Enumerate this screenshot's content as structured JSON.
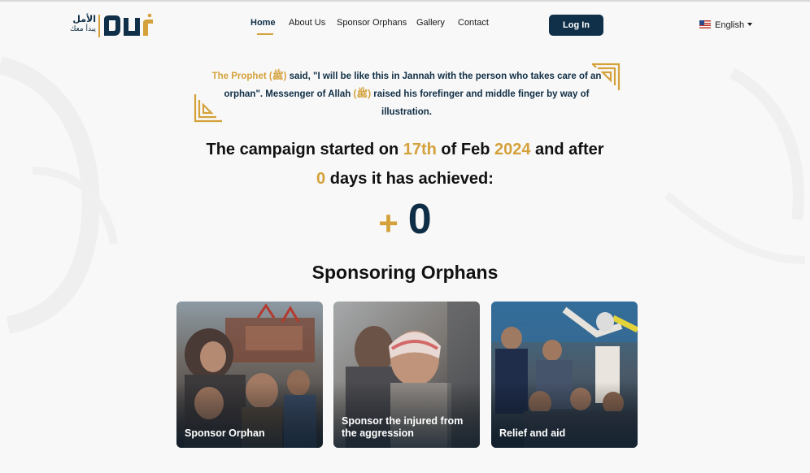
{
  "header": {
    "logo": {
      "arabic_name": "الأمل",
      "arabic_tagline": "يبدأ معك"
    },
    "nav": [
      {
        "label": "Home",
        "active": true
      },
      {
        "label": "About Us",
        "active": false
      },
      {
        "label": "Sponsor Orphans",
        "active": false
      },
      {
        "label": "Gallery",
        "active": false
      },
      {
        "label": "Contact",
        "active": false
      }
    ],
    "login_label": "Log In",
    "language": {
      "selected": "English",
      "flag_icon": "us-flag-icon"
    }
  },
  "hadith": {
    "prefix": "The Prophet (ﷺ)",
    "line1_rest": " said, \"I will be like this in Jannah with the person who takes care of an",
    "line2_start": "orphan\". Messenger of Allah ",
    "pbuh": "(ﷺ)",
    "line2_rest": " raised his forefinger and middle finger by way of",
    "line3": "illustration."
  },
  "campaign": {
    "text1": "The campaign started on ",
    "day": "17th",
    "text2": " of Feb ",
    "year": "2024",
    "text3": " and after",
    "days": "0",
    "text4": " days it has achieved:",
    "plus": "+",
    "achieved": "0"
  },
  "section_title": "Sponsoring Orphans",
  "cards": [
    {
      "label": "Sponsor Orphan"
    },
    {
      "label": "Sponsor the injured from the aggression"
    },
    {
      "label": "Relief and aid"
    }
  ],
  "colors": {
    "navy": "#0f3048",
    "gold": "#d4a13a",
    "background": "#f8f8f8"
  }
}
